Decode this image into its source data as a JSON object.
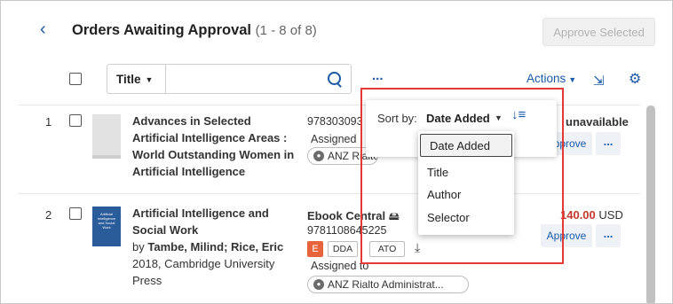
{
  "header": {
    "back_icon": "chevron-left-icon",
    "title": "Orders Awaiting Approval",
    "count": "(1 - 8 of 8)",
    "approve_selected_label": "Approve Selected"
  },
  "toolbar": {
    "search_scope": "Title",
    "search_value": "",
    "more_label": "...",
    "actions_label": "Actions",
    "export_icon": "export-icon",
    "settings_icon": "gear-icon"
  },
  "sort": {
    "label": "Sort by:",
    "selected": "Date Added",
    "direction_icon": "sort-descending-icon",
    "options": [
      "Date Added",
      "Title",
      "Author",
      "Selector"
    ]
  },
  "rows": [
    {
      "num": "1",
      "title_lines": [
        "Advances in Selected",
        "Artificial Intelligence Areas :",
        "World Outstanding Women in",
        "Artificial Intelligence"
      ],
      "isbn": "978303093",
      "assigned_prefix": "Assigned",
      "assignee": "ANZ Rialto Admini",
      "price_status": "unavailable",
      "approve_label": "Approve",
      "more_label": "..."
    },
    {
      "num": "2",
      "title_lines": [
        "Artificial Intelligence and",
        "Social Work"
      ],
      "by_prefix": "by",
      "authors": "Tambe, Milind; Rice, Eric",
      "pub_line1": "2018, Cambridge University",
      "pub_line2": "Press",
      "cover_text": [
        "Artificial",
        "Intelligence",
        "and Social",
        "Work"
      ],
      "platform": "Ebook Central",
      "isbn": "9781108645225",
      "tags": [
        "E",
        "DDA",
        "ATO"
      ],
      "assigned_label": "Assigned to",
      "assignee": "ANZ Rialto Administrat...",
      "price_amount": "140.00",
      "price_currency": "USD",
      "approve_label": "Approve",
      "more_label": "..."
    }
  ],
  "colors": {
    "accent": "#1a5aa8",
    "highlight": "#e53935",
    "price": "#c0392b",
    "ebook_tag": "#e8643c"
  }
}
